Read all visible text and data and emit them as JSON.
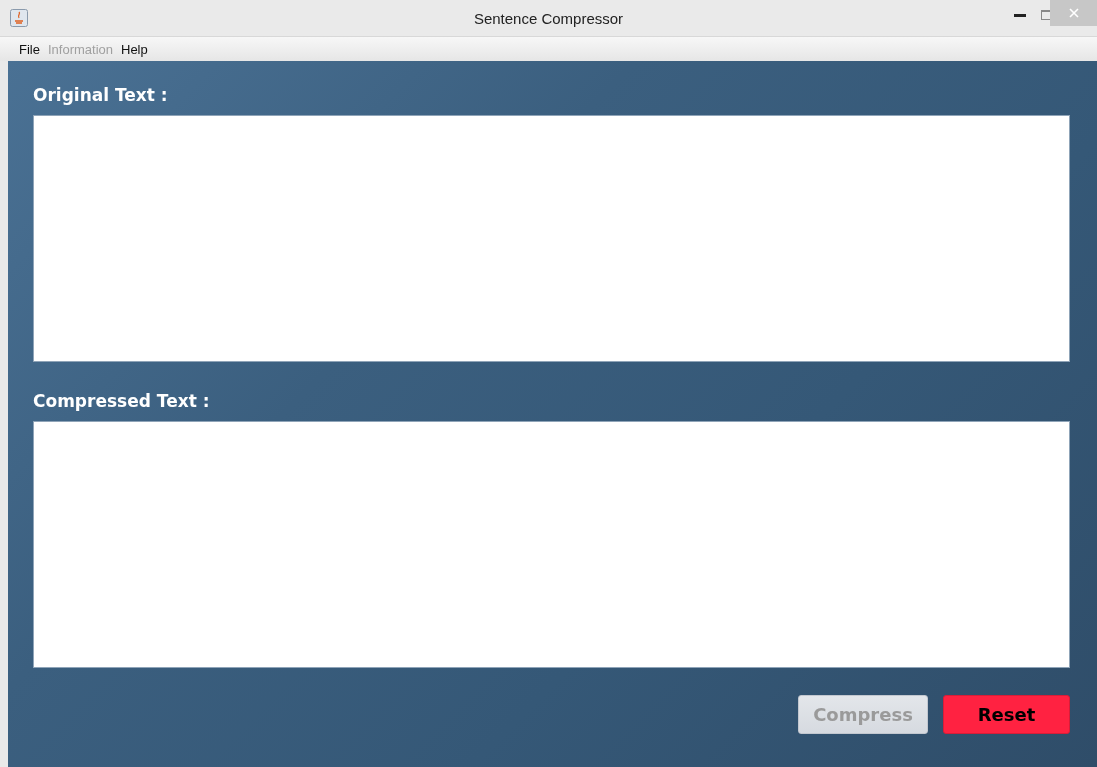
{
  "window": {
    "title": "Sentence Compressor"
  },
  "menu": [
    {
      "label": "File",
      "disabled": false
    },
    {
      "label": "Information",
      "disabled": true
    },
    {
      "label": "Help",
      "disabled": false
    }
  ],
  "fields": [
    {
      "label": "Original Text :"
    },
    {
      "label": "Compressed Text :"
    }
  ],
  "buttons": [
    {
      "label": "Compress",
      "kind": "primary",
      "disabled": true
    },
    {
      "label": "Reset",
      "kind": "danger",
      "disabled": false
    }
  ]
}
